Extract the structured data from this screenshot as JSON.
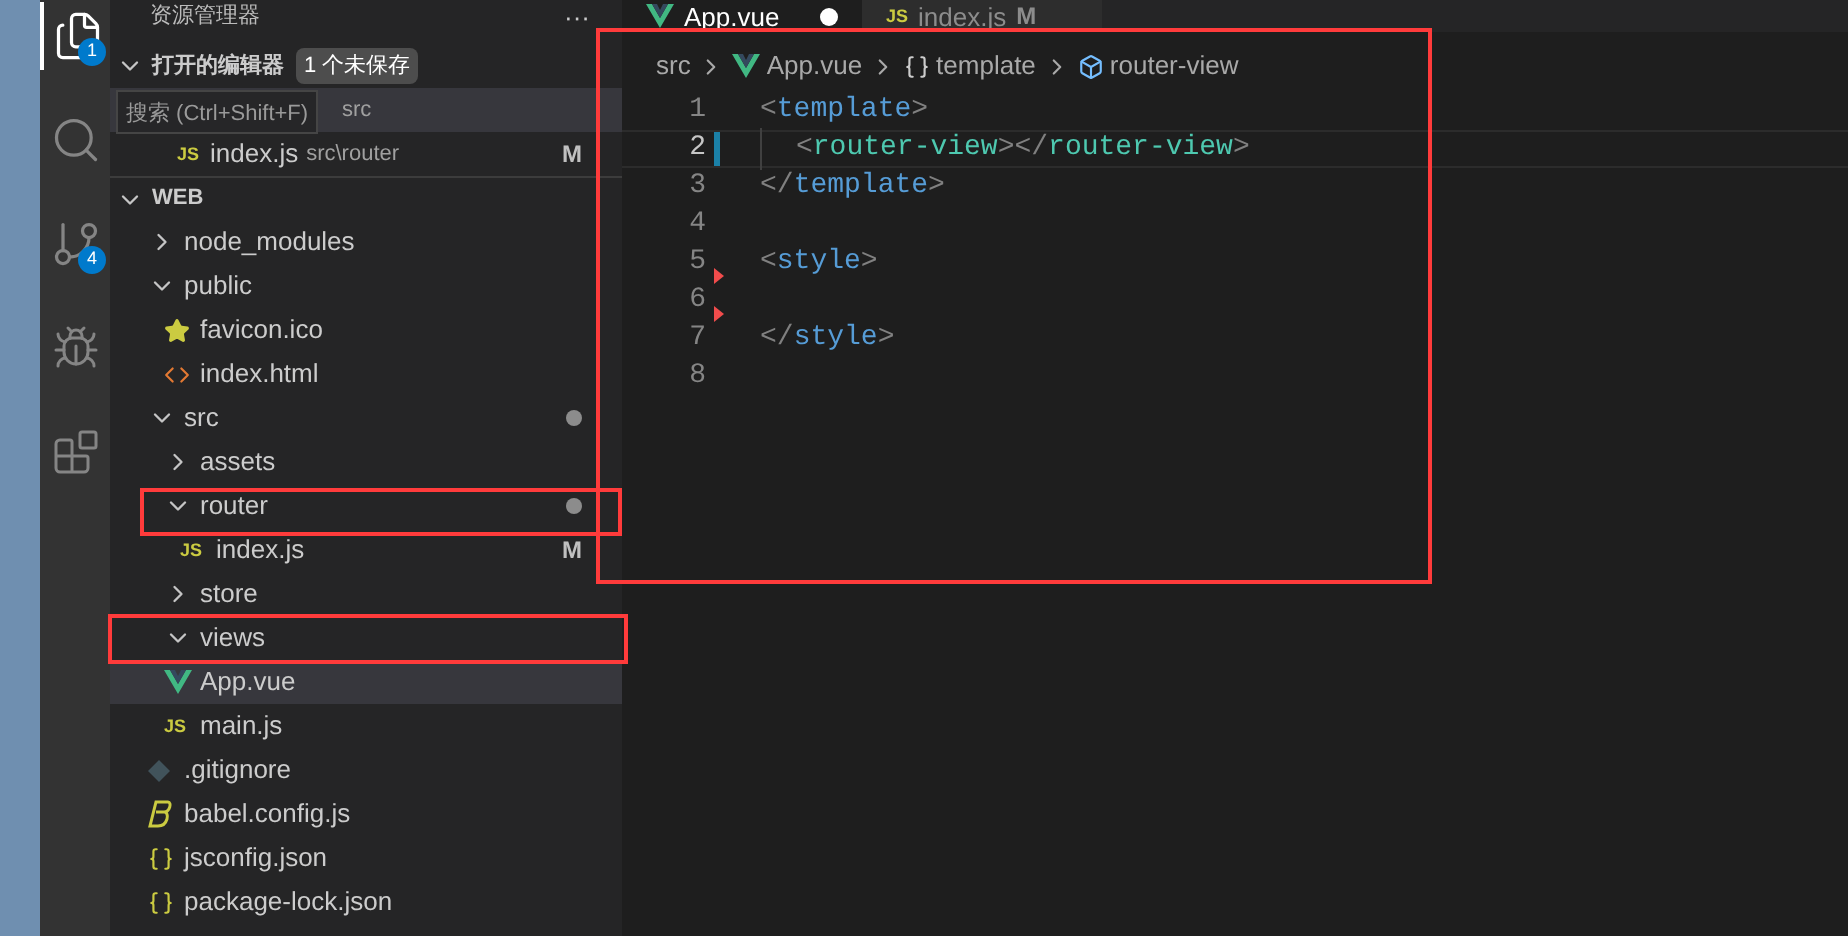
{
  "activity_bar": [
    {
      "selected": true,
      "badge": "1"
    },
    {
      "selected": false
    },
    {
      "selected": false,
      "badge": "4"
    },
    {
      "selected": false
    },
    {
      "selected": false
    }
  ],
  "tooltip": "搜索 (Ctrl+Shift+F)",
  "sidebar": {
    "title": "资源管理器",
    "more": "···",
    "open_editors": {
      "title": "打开的编辑器",
      "unsaved": "1 个未保存",
      "expanded": true,
      "items": [
        {
          "path": "src",
          "selected": true
        },
        {
          "name": "index.js",
          "path": "src\\router",
          "kind": "js",
          "icon_label": "JS",
          "selected": false,
          "git": "M"
        }
      ]
    },
    "workspace": {
      "title": "WEB",
      "expanded": true,
      "tree": [
        {
          "name": "node_modules",
          "kind": "folder",
          "expanded": false,
          "selected": false
        },
        {
          "name": "public",
          "kind": "folder",
          "expanded": true,
          "selected": false,
          "children": [
            {
              "name": "favicon.ico",
              "kind": "ico",
              "selected": false
            },
            {
              "name": "index.html",
              "kind": "html",
              "selected": false
            }
          ]
        },
        {
          "name": "src",
          "kind": "folder",
          "expanded": true,
          "selected": false,
          "dot": true,
          "children": [
            {
              "name": "assets",
              "kind": "folder",
              "expanded": false,
              "selected": false
            },
            {
              "name": "router",
              "kind": "folder",
              "expanded": true,
              "selected": false,
              "dot": true,
              "children": [
                {
                  "name": "index.js",
                  "kind": "js",
                  "icon_label": "JS",
                  "selected": false,
                  "git": "M"
                }
              ]
            },
            {
              "name": "store",
              "kind": "folder",
              "expanded": false,
              "selected": false
            },
            {
              "name": "views",
              "kind": "folder",
              "expanded": true,
              "selected": false
            },
            {
              "name": "App.vue",
              "kind": "vue",
              "selected": true
            },
            {
              "name": "main.js",
              "kind": "js",
              "icon_label": "JS",
              "selected": false
            }
          ]
        },
        {
          "name": ".gitignore",
          "kind": "gitignore",
          "selected": false
        },
        {
          "name": "babel.config.js",
          "kind": "babel",
          "selected": false
        },
        {
          "name": "jsconfig.json",
          "kind": "json",
          "selected": false
        },
        {
          "name": "package-lock.json",
          "kind": "json",
          "selected": false
        }
      ]
    }
  },
  "tabs": [
    {
      "label": "App.vue",
      "kind": "vue",
      "selected": true,
      "dirty": true
    },
    {
      "label": "index.js",
      "kind": "js",
      "icon_label": "JS",
      "selected": false,
      "git": "M"
    }
  ],
  "breadcrumb": [
    {
      "label": "src",
      "kind": "folder"
    },
    {
      "label": "App.vue",
      "kind": "vue"
    },
    {
      "label": "template",
      "kind": "block"
    },
    {
      "label": "router-view",
      "kind": "element"
    }
  ],
  "code": [
    {
      "number": "1",
      "tokens": [
        {
          "text": "<",
          "kind": "punct"
        },
        {
          "text": "template",
          "kind": "tag"
        },
        {
          "text": ">",
          "kind": "punct"
        }
      ]
    },
    {
      "number": "2",
      "current": true,
      "modified": true,
      "tokens": [
        {
          "text": "<",
          "kind": "punct"
        },
        {
          "text": "router-view",
          "kind": "component"
        },
        {
          "text": "></",
          "kind": "punct"
        },
        {
          "text": "router-view",
          "kind": "component"
        },
        {
          "text": ">",
          "kind": "punct"
        }
      ]
    },
    {
      "number": "3",
      "tokens": [
        {
          "text": "</",
          "kind": "punct"
        },
        {
          "text": "template",
          "kind": "tag"
        },
        {
          "text": ">",
          "kind": "punct"
        }
      ]
    },
    {
      "number": "4"
    },
    {
      "number": "5",
      "deleted": true,
      "tokens": [
        {
          "text": "<",
          "kind": "punct"
        },
        {
          "text": "style",
          "kind": "tag"
        },
        {
          "text": ">",
          "kind": "punct"
        }
      ]
    },
    {
      "number": "6",
      "deleted": true
    },
    {
      "number": "7",
      "tokens": [
        {
          "text": "</",
          "kind": "punct"
        },
        {
          "text": "style",
          "kind": "tag"
        },
        {
          "text": ">",
          "kind": "punct"
        }
      ]
    },
    {
      "number": "8"
    }
  ]
}
